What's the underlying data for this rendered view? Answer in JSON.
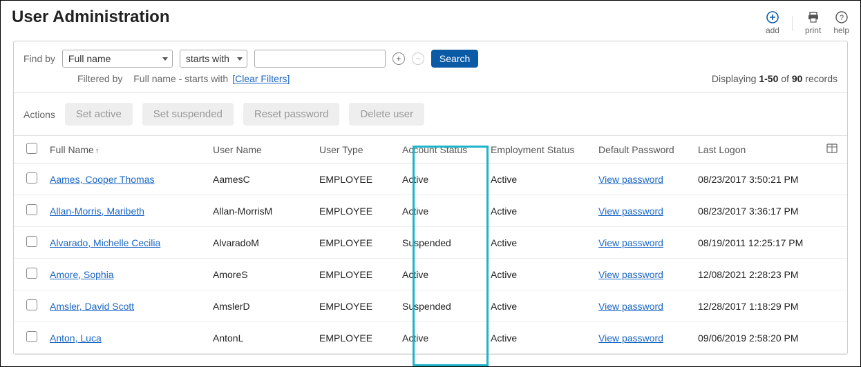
{
  "title": "User Administration",
  "header_actions": {
    "add": "add",
    "print": "print",
    "help": "help"
  },
  "filter": {
    "find_by_label": "Find by",
    "field_select_value": "Full name",
    "condition_select_value": "starts with",
    "search_value": "",
    "search_button": "Search",
    "filtered_by_label": "Filtered by",
    "filtered_by_text": "Full name - starts with",
    "clear_filters_label": "[Clear Filters]"
  },
  "pagination": {
    "displaying_prefix": "Displaying ",
    "range": "1-50",
    "of": " of ",
    "total": "90",
    "suffix": " records"
  },
  "actions": {
    "label": "Actions",
    "set_active": "Set active",
    "set_suspended": "Set suspended",
    "reset_password": "Reset password",
    "delete_user": "Delete user"
  },
  "columns": {
    "full_name": "Full Name",
    "user_name": "User Name",
    "user_type": "User Type",
    "account_status": "Account Status",
    "employment_status": "Employment Status",
    "default_password": "Default Password",
    "last_logon": "Last Logon"
  },
  "view_password_label": "View password",
  "rows": [
    {
      "full_name": "Aames, Cooper Thomas",
      "user_name": "AamesC",
      "user_type": "EMPLOYEE",
      "account_status": "Active",
      "employment_status": "Active",
      "last_logon": "08/23/2017 3:50:21 PM"
    },
    {
      "full_name": "Allan-Morris, Maribeth",
      "user_name": "Allan-MorrisM",
      "user_type": "EMPLOYEE",
      "account_status": "Active",
      "employment_status": "Active",
      "last_logon": "08/23/2017 3:36:17 PM"
    },
    {
      "full_name": "Alvarado, Michelle Cecilia",
      "user_name": "AlvaradoM",
      "user_type": "EMPLOYEE",
      "account_status": "Suspended",
      "employment_status": "Active",
      "last_logon": "08/19/2011 12:25:17 PM"
    },
    {
      "full_name": "Amore, Sophia",
      "user_name": "AmoreS",
      "user_type": "EMPLOYEE",
      "account_status": "Active",
      "employment_status": "Active",
      "last_logon": "12/08/2021 2:28:23 PM"
    },
    {
      "full_name": "Amsler, David Scott",
      "user_name": "AmslerD",
      "user_type": "EMPLOYEE",
      "account_status": "Suspended",
      "employment_status": "Active",
      "last_logon": "12/28/2017 1:18:29 PM"
    },
    {
      "full_name": "Anton, Luca",
      "user_name": "AntonL",
      "user_type": "EMPLOYEE",
      "account_status": "Active",
      "employment_status": "Active",
      "last_logon": "09/06/2019 2:58:20 PM"
    }
  ]
}
